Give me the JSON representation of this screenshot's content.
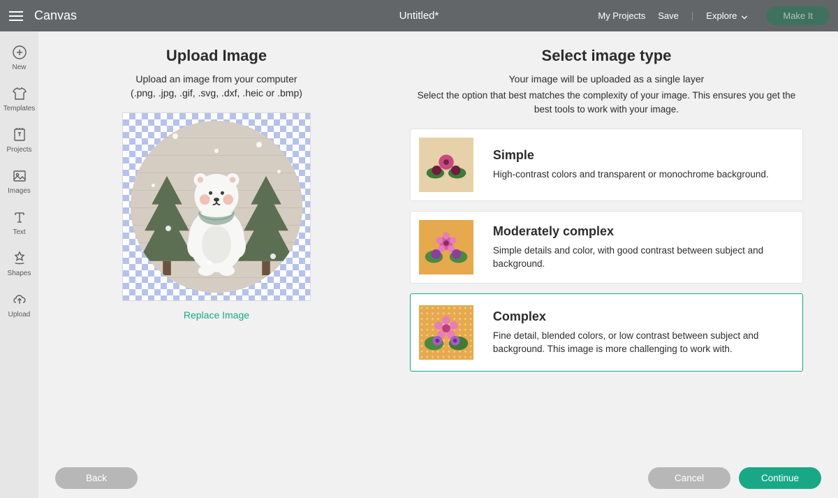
{
  "topbar": {
    "brand": "Canvas",
    "title": "Untitled*",
    "my_projects": "My Projects",
    "save": "Save",
    "explore": "Explore",
    "make_it": "Make It"
  },
  "sidebar": {
    "items": [
      {
        "label": "New"
      },
      {
        "label": "Templates"
      },
      {
        "label": "Projects"
      },
      {
        "label": "Images"
      },
      {
        "label": "Text"
      },
      {
        "label": "Shapes"
      },
      {
        "label": "Upload"
      }
    ]
  },
  "left": {
    "title": "Upload Image",
    "line1": "Upload an image from your computer",
    "line2": "(.png, .jpg, .gif, .svg, .dxf, .heic or .bmp)",
    "replace": "Replace Image"
  },
  "right": {
    "title": "Select image type",
    "line1": "Your image will be uploaded as a single layer",
    "line2": "Select the option that best matches the complexity of your image. This ensures you get the best tools to work with your image.",
    "options": [
      {
        "title": "Simple",
        "desc": "High-contrast colors and transparent or monochrome background."
      },
      {
        "title": "Moderately complex",
        "desc": "Simple details and color, with good contrast between subject and background."
      },
      {
        "title": "Complex",
        "desc": "Fine detail, blended colors, or low contrast between subject and background. This image is more challenging to work with."
      }
    ],
    "selected_index": 2
  },
  "footer": {
    "back": "Back",
    "cancel": "Cancel",
    "continue": "Continue"
  },
  "colors": {
    "accent": "#18a888",
    "topbar": "#636668"
  }
}
